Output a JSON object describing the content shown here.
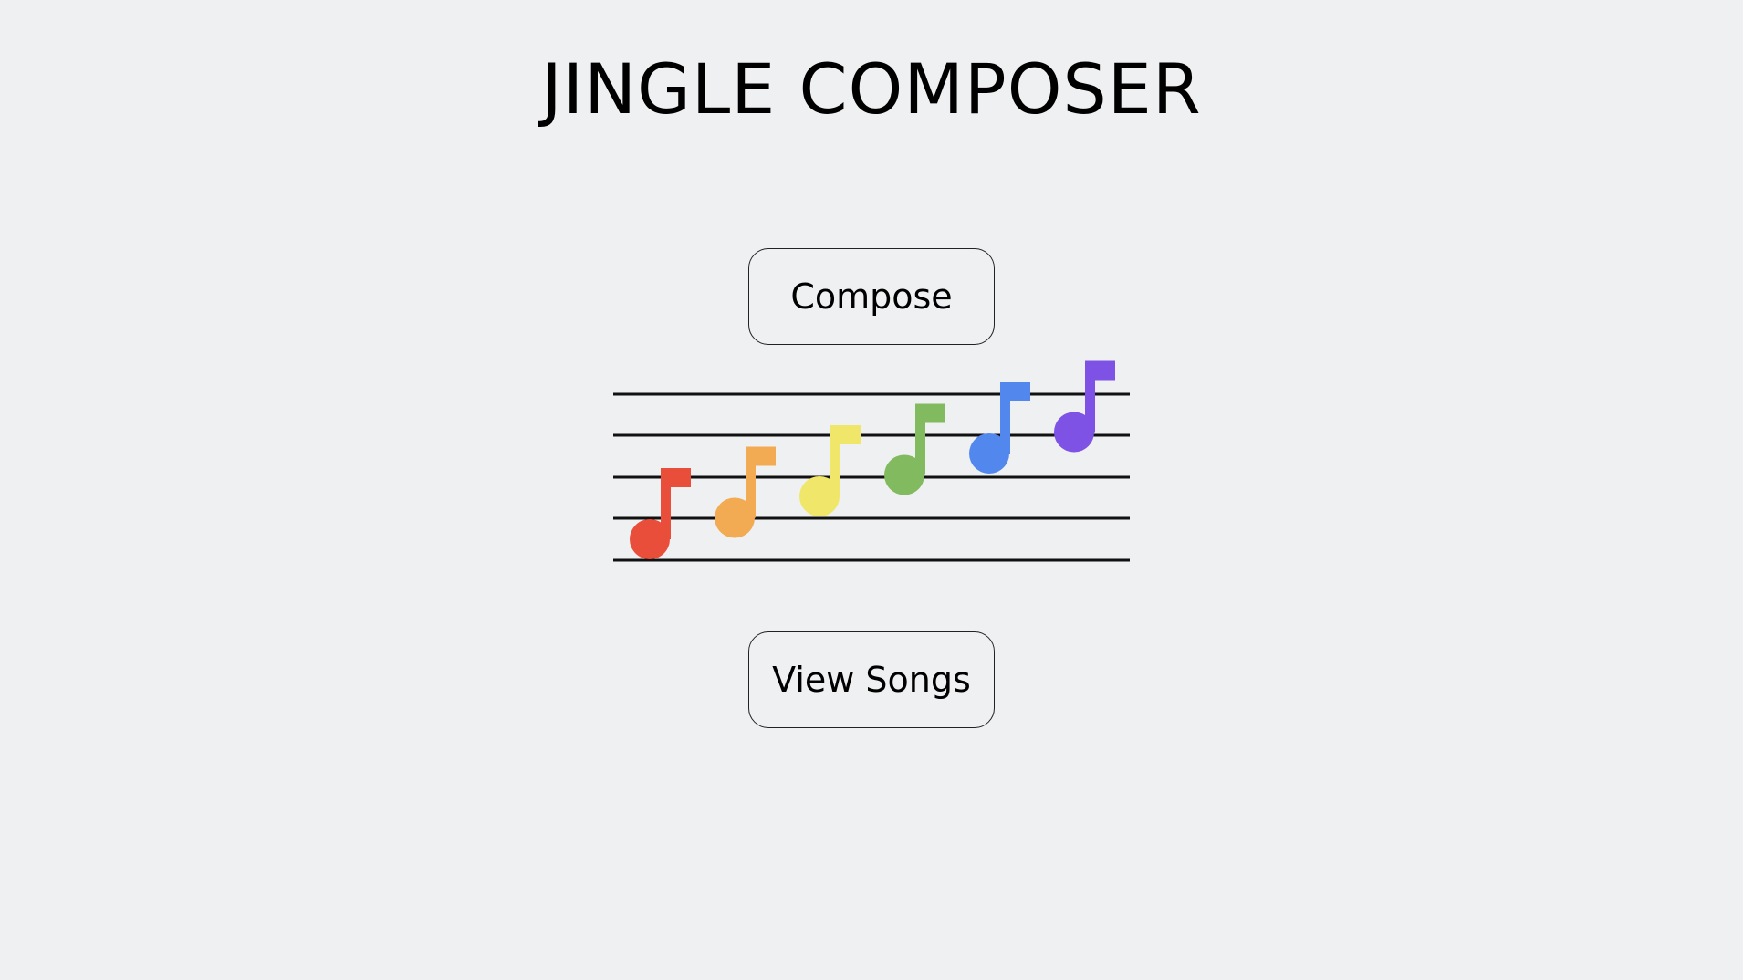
{
  "app": {
    "title": "JINGLE COMPOSER"
  },
  "buttons": {
    "compose_label": "Compose",
    "view_songs_label": "View Songs"
  },
  "illustration": {
    "icon": "rainbow-music-notes-on-staff",
    "staff_lines": 5,
    "note_colors": [
      "#e94e3b",
      "#f2ab52",
      "#f0e76a",
      "#82bb5f",
      "#5288ee",
      "#7d52e5"
    ],
    "staff_color": "#111111"
  },
  "theme": {
    "background": "#eff0f2",
    "text": "#000000"
  }
}
